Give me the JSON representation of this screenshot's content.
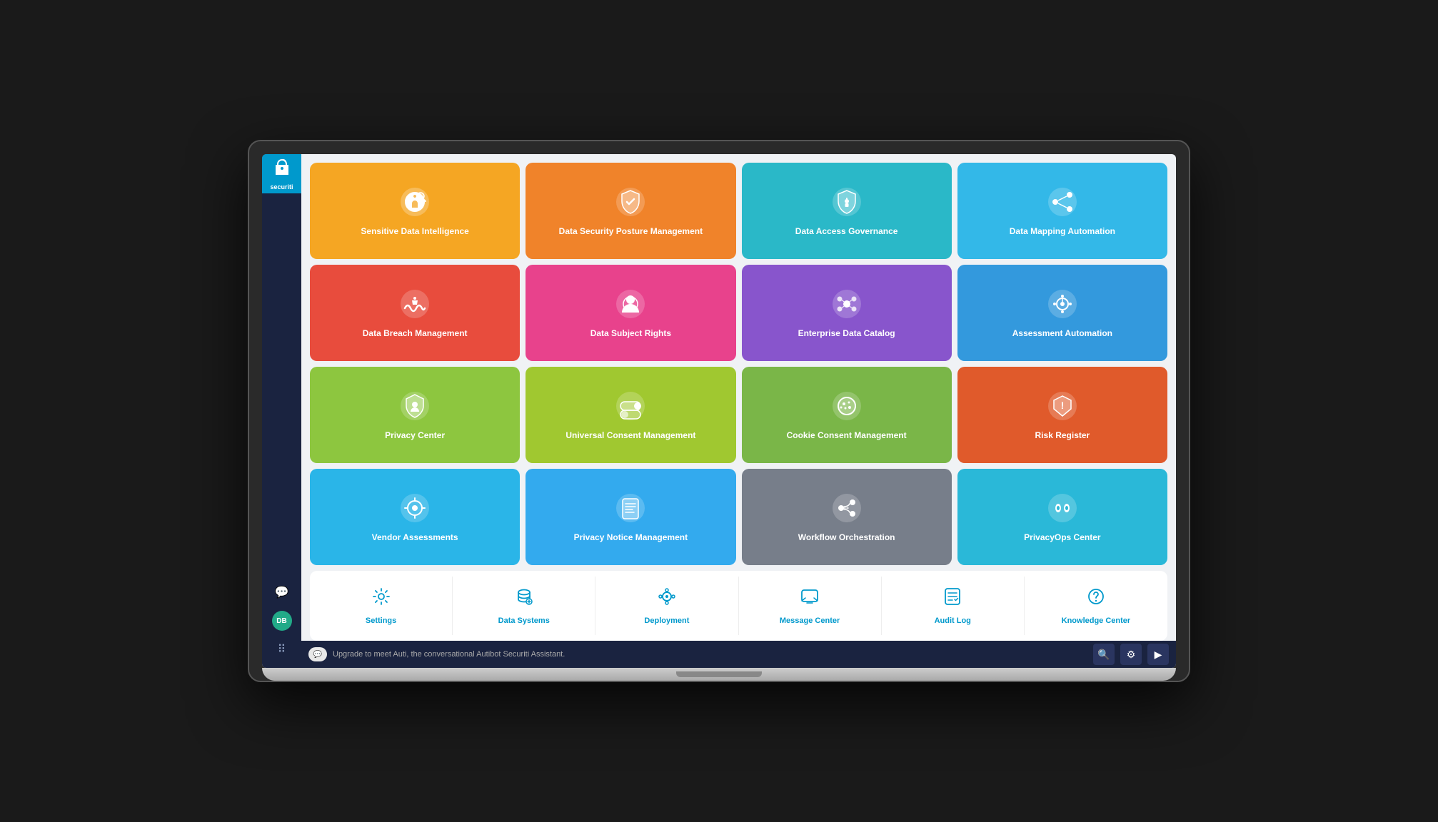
{
  "app": {
    "name": "securiti",
    "logo_text": "securiti"
  },
  "tiles": [
    {
      "id": "sensitive-data-intelligence",
      "label": "Sensitive Data Intelligence",
      "color": "orange",
      "icon": "shield-search"
    },
    {
      "id": "data-security-posture",
      "label": "Data Security Posture Management",
      "color": "orange2",
      "icon": "shield-check"
    },
    {
      "id": "data-access-governance",
      "label": "Data Access Governance",
      "color": "teal",
      "icon": "shield-lock"
    },
    {
      "id": "data-mapping-automation",
      "label": "Data Mapping Automation",
      "color": "blue-light",
      "icon": "share-nodes"
    },
    {
      "id": "data-breach-management",
      "label": "Data Breach Management",
      "color": "red-orange",
      "icon": "wifi-alert"
    },
    {
      "id": "data-subject-rights",
      "label": "Data Subject Rights",
      "color": "pink",
      "icon": "circle-user"
    },
    {
      "id": "enterprise-data-catalog",
      "label": "Enterprise Data Catalog",
      "color": "purple",
      "icon": "circles"
    },
    {
      "id": "assessment-automation",
      "label": "Assessment Automation",
      "color": "blue-med",
      "icon": "circle-radar"
    },
    {
      "id": "privacy-center",
      "label": "Privacy Center",
      "color": "lime",
      "icon": "hexagon-user"
    },
    {
      "id": "universal-consent",
      "label": "Universal Consent Management",
      "color": "yellow-green",
      "icon": "toggle"
    },
    {
      "id": "cookie-consent",
      "label": "Cookie Consent Management",
      "color": "green",
      "icon": "cookie"
    },
    {
      "id": "risk-register",
      "label": "Risk Register",
      "color": "red",
      "icon": "shield-exclaim"
    },
    {
      "id": "vendor-assessments",
      "label": "Vendor Assessments",
      "color": "sky",
      "icon": "settings-dots"
    },
    {
      "id": "privacy-notice",
      "label": "Privacy Notice Management",
      "color": "blue2",
      "icon": "document"
    },
    {
      "id": "workflow-orchestration",
      "label": "Workflow Orchestration",
      "color": "gray",
      "icon": "flow"
    },
    {
      "id": "privacyops-center",
      "label": "PrivacyOps Center",
      "color": "cyan",
      "icon": "eyes"
    }
  ],
  "utility_tiles": [
    {
      "id": "settings",
      "label": "Settings",
      "icon": "gear"
    },
    {
      "id": "data-systems",
      "label": "Data Systems",
      "icon": "database-search"
    },
    {
      "id": "deployment",
      "label": "Deployment",
      "icon": "gear-dots"
    },
    {
      "id": "message-center",
      "label": "Message Center",
      "icon": "message"
    },
    {
      "id": "audit-log",
      "label": "Audit Log",
      "icon": "list-check"
    },
    {
      "id": "knowledge-center",
      "label": "Knowledge Center",
      "icon": "circle-question"
    }
  ],
  "bottom_bar": {
    "chat_text": "Upgrade to meet Auti, the conversational Autibot Securiti Assistant."
  },
  "sidebar": {
    "avatar_initials": "DB"
  }
}
